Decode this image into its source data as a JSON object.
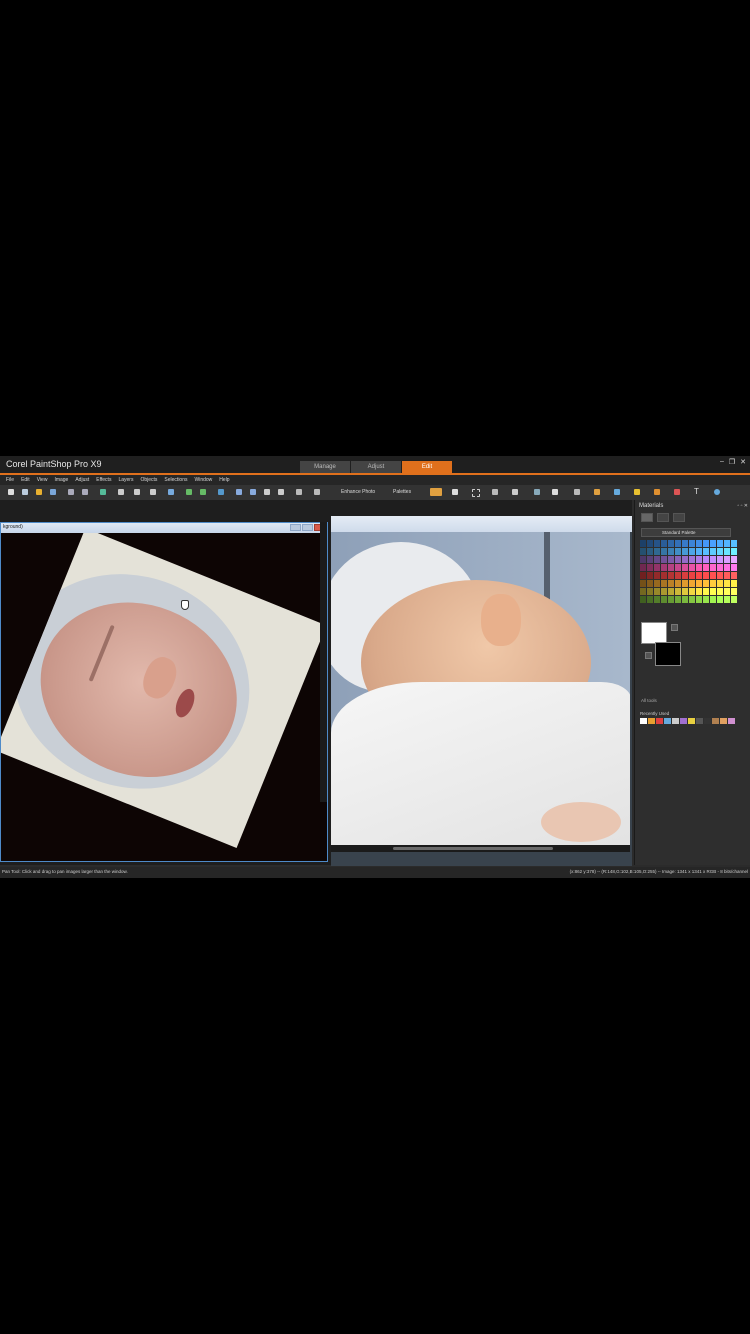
{
  "app": {
    "title": "Corel PaintShop Pro X9",
    "tabs": [
      {
        "label": "Manage",
        "active": false
      },
      {
        "label": "Adjust",
        "active": false
      },
      {
        "label": "Edit",
        "active": true
      }
    ],
    "window_controls": [
      "–",
      "❐",
      "✕"
    ]
  },
  "menu": [
    "File",
    "Edit",
    "View",
    "Image",
    "Adjust",
    "Effects",
    "Layers",
    "Objects",
    "Selections",
    "Window",
    "Help"
  ],
  "toolbar": {
    "enhance_photo_label": "Enhance Photo",
    "palettes_label": "Palettes",
    "text_tool_glyph": "T"
  },
  "document_left": {
    "title": "kground)"
  },
  "materials_panel": {
    "title": "Materials",
    "palette_name": "Standard Palette",
    "all_tools_label": "All tools",
    "recently_used_label": "Recently Used",
    "colors": {
      "foreground": "#ffffff",
      "background": "#000000",
      "accent": "#e0701c"
    }
  },
  "status": {
    "left_text": "Pan Tool: Click and drag to pan images larger than the window.",
    "right_text": "(x:862 y:378) -- (R:148,G:102,B:105,O:255) -- Image: 1341 x 1341 x RGB - 8 bits/channel"
  }
}
